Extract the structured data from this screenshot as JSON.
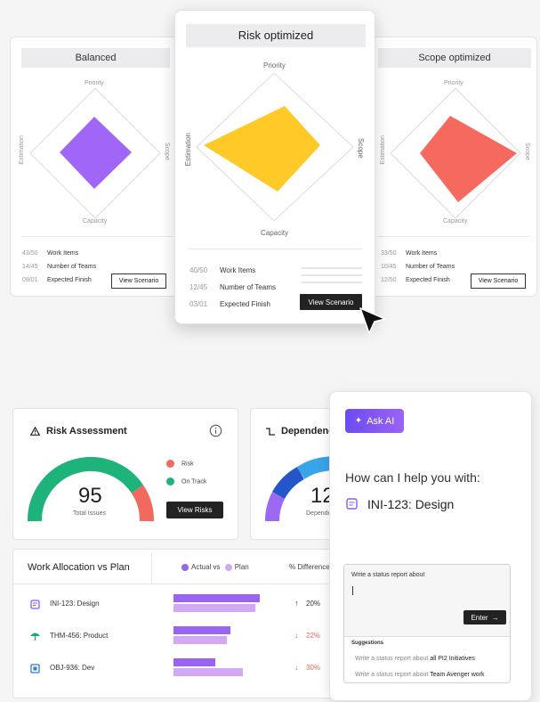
{
  "scenarios": [
    {
      "title": "Balanced",
      "axes": {
        "top": "Priority",
        "bottom": "Capacity",
        "left": "Estimation",
        "right": "Scope"
      },
      "stats": [
        {
          "value": "43/50",
          "label": "Work Items"
        },
        {
          "value": "14/45",
          "label": "Number of Teams"
        },
        {
          "value": "09/01",
          "label": "Expected Finish"
        }
      ],
      "button": "View Scenario",
      "color": "#a066f5"
    },
    {
      "title": "Risk optimized",
      "axes": {
        "top": "Priority",
        "bottom": "Capacity",
        "left": "Estimation",
        "right": "Scope"
      },
      "stats": [
        {
          "value": "40/50",
          "label": "Work Items"
        },
        {
          "value": "12/45",
          "label": "Number of Teams"
        },
        {
          "value": "03/01",
          "label": "Expected Finish"
        }
      ],
      "button": "View Scenario",
      "color": "#ffc928"
    },
    {
      "title": "Scope optimized",
      "axes": {
        "top": "Priority",
        "bottom": "Capacity",
        "left": "Estimation",
        "right": "Scope"
      },
      "stats": [
        {
          "value": "33/50",
          "label": "Work Items"
        },
        {
          "value": "10/45",
          "label": "Number of Teams"
        },
        {
          "value": "12/50",
          "label": "Expected Finish"
        }
      ],
      "button": "View Scenario",
      "color": "#f5695f"
    }
  ],
  "risk": {
    "title": "Risk Assessment",
    "info_icon": "info-icon",
    "value": "95",
    "value_label": "Total Issues",
    "legend": [
      {
        "label": "Risk",
        "color": "#f06a5f"
      },
      {
        "label": "On Track",
        "color": "#1fb37c"
      }
    ],
    "button": "View Risks"
  },
  "dependencies": {
    "title": "Dependenc",
    "value": "12",
    "value_label": "Depende"
  },
  "allocation": {
    "title": "Work Allocation vs Plan",
    "legend_actual": "Actual vs",
    "legend_plan": "Plan",
    "diff_header": "% Difference",
    "colors": {
      "actual": "#9b63f2",
      "plan": "#d3a8f5"
    },
    "rows": [
      {
        "name": "INI-123: Design",
        "actual": 97,
        "plan": 92,
        "trend": "up",
        "diff": "20%",
        "icon_color": "#8a5cf5"
      },
      {
        "name": "THM-456: Product",
        "actual": 64,
        "plan": 60,
        "trend": "down",
        "diff": "22%",
        "icon_color": "#1fa572"
      },
      {
        "name": "OBJ-936: Dev",
        "actual": 47,
        "plan": 78,
        "trend": "down",
        "diff": "30%",
        "icon_color": "#2a7fd6"
      }
    ]
  },
  "ai": {
    "button": "Ask AI",
    "prompt": "How can I help you with:",
    "item": "INI-123: Design",
    "input_label": "Write a status report about",
    "enter": "Enter",
    "suggestions_title": "Suggestions",
    "suggestions": [
      {
        "prefix": "Write a status report about",
        "highlight": "all PI2 Initiatives"
      },
      {
        "prefix": "Write a status report about",
        "highlight": "Team Avenger work"
      }
    ]
  }
}
